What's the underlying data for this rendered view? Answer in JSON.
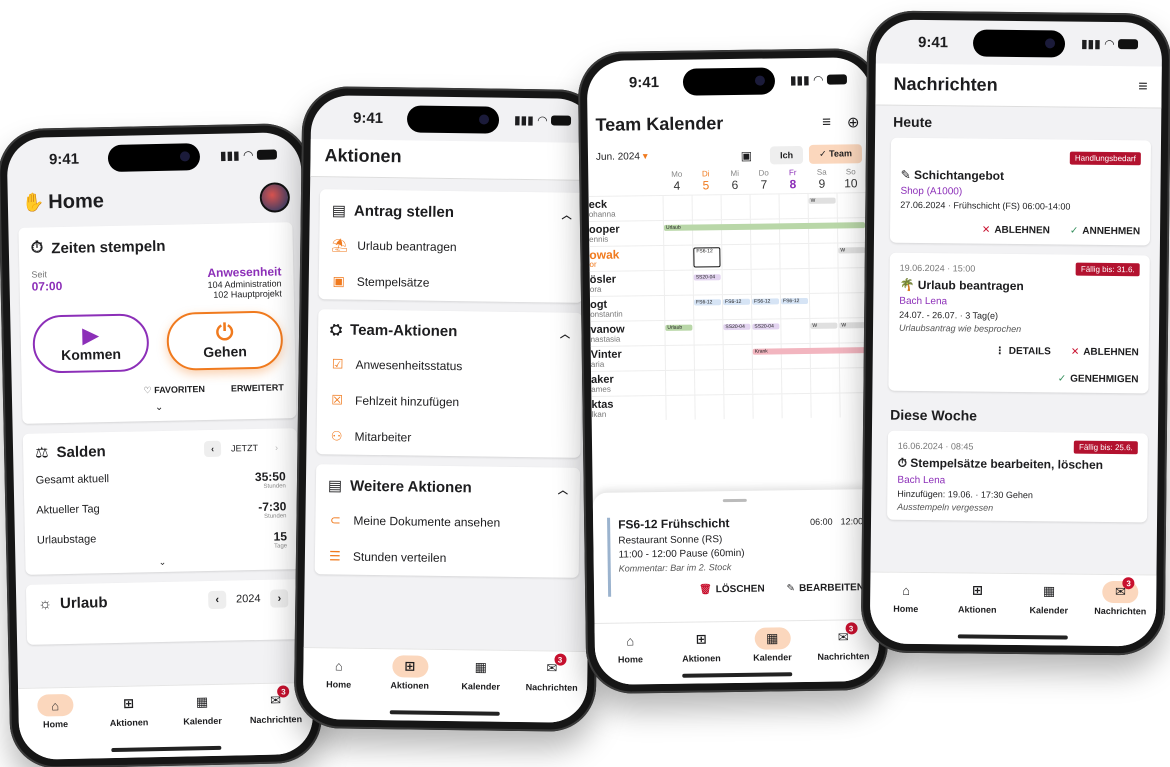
{
  "status_time": "9:41",
  "nav": {
    "home": "Home",
    "aktionen": "Aktionen",
    "kalender": "Kalender",
    "nachrichten": "Nachrichten",
    "badge": "3"
  },
  "home": {
    "title": "Home",
    "stempeln_title": "Zeiten stempeln",
    "seit_label": "Seit",
    "seit_time": "07:00",
    "anwesenheit": "Anwesenheit",
    "admin": "104 Administration",
    "projekt": "102 Hauptprojekt",
    "kommen": "Kommen",
    "gehen": "Gehen",
    "favoriten": "FAVORITEN",
    "erweitert": "ERWEITERT",
    "salden_title": "Salden",
    "jetzt": "JETZT",
    "salden_rows": [
      {
        "label": "Gesamt aktuell",
        "value": "35:50",
        "unit": "Stunden"
      },
      {
        "label": "Aktueller Tag",
        "value": "-7:30",
        "unit": "Stunden"
      },
      {
        "label": "Urlaubstage",
        "value": "15",
        "unit": "Tage"
      }
    ],
    "urlaub_title": "Urlaub",
    "year": "2024"
  },
  "aktionen": {
    "title": "Aktionen",
    "antrag_title": "Antrag stellen",
    "antrag_items": [
      "Urlaub beantragen",
      "Stempelsätze"
    ],
    "team_title": "Team-Aktionen",
    "team_items": [
      "Anwesenheitsstatus",
      "Fehlzeit hinzufügen",
      "Mitarbeiter"
    ],
    "weitere_title": "Weitere Aktionen",
    "weitere_items": [
      "Meine Dokumente ansehen",
      "Stunden verteilen"
    ]
  },
  "kalender": {
    "title": "Team Kalender",
    "month": "Jun. 2024",
    "ich": "Ich",
    "team": "Team",
    "days": [
      {
        "d": "Mo",
        "n": "4"
      },
      {
        "d": "Di",
        "n": "5"
      },
      {
        "d": "Mi",
        "n": "6"
      },
      {
        "d": "Do",
        "n": "7"
      },
      {
        "d": "Fr",
        "n": "8"
      },
      {
        "d": "Sa",
        "n": "9"
      },
      {
        "d": "So",
        "n": "10"
      }
    ],
    "people": [
      {
        "last": "eck",
        "first": "ohanna"
      },
      {
        "last": "ooper",
        "first": "ennis"
      },
      {
        "last": "owak",
        "first": "or"
      },
      {
        "last": "ösler",
        "first": "ora"
      },
      {
        "last": "ogt",
        "first": "onstantin"
      },
      {
        "last": "vanow",
        "first": "nastasia"
      },
      {
        "last": "Vinter",
        "first": "aria"
      },
      {
        "last": "aker",
        "first": "ames"
      },
      {
        "last": "ktas",
        "first": "lkan"
      }
    ],
    "labels": {
      "w": "W",
      "urlaub": "Urlaub",
      "fs612": "FS6-12",
      "ss2004": "SS20-04",
      "krank": "Krank"
    },
    "detail": {
      "title": "FS6-12 Frühschicht",
      "start": "06:00",
      "end": "12:00",
      "place": "Restaurant Sonne (RS)",
      "pause": "11:00 - 12:00 Pause (60min)",
      "comment": "Kommentar: Bar im 2. Stock",
      "loeschen": "LÖSCHEN",
      "bearbeiten": "BEARBEITEN"
    }
  },
  "nachrichten": {
    "title": "Nachrichten",
    "heute": "Heute",
    "diese_woche": "Diese Woche",
    "msg1": {
      "tag": "Handlungsbedarf",
      "title": "Schichtangebot",
      "shop": "Shop (A1000)",
      "detail": "27.06.2024 · Frühschicht (FS) 06:00-14:00",
      "ablehnen": "ABLEHNEN",
      "annehmen": "ANNEHMEN"
    },
    "msg2": {
      "date": "19.06.2024 · 15:00",
      "tag": "Fällig bis: 31.6.",
      "title": "Urlaub beantragen",
      "name": "Bach Lena",
      "detail": "24.07. - 26.07. · 3 Tag(e)",
      "comment": "Urlaubsantrag wie besprochen",
      "details": "DETAILS",
      "ablehnen": "ABLEHNEN",
      "genehmigen": "GENEHMIGEN"
    },
    "msg3": {
      "date": "16.06.2024 · 08:45",
      "tag": "Fällig bis: 25.6.",
      "title": "Stempelsätze bearbeiten, löschen",
      "name": "Bach Lena",
      "detail": "Hinzufügen: 19.06. · 17:30 Gehen",
      "comment": "Ausstempeln vergessen"
    }
  }
}
